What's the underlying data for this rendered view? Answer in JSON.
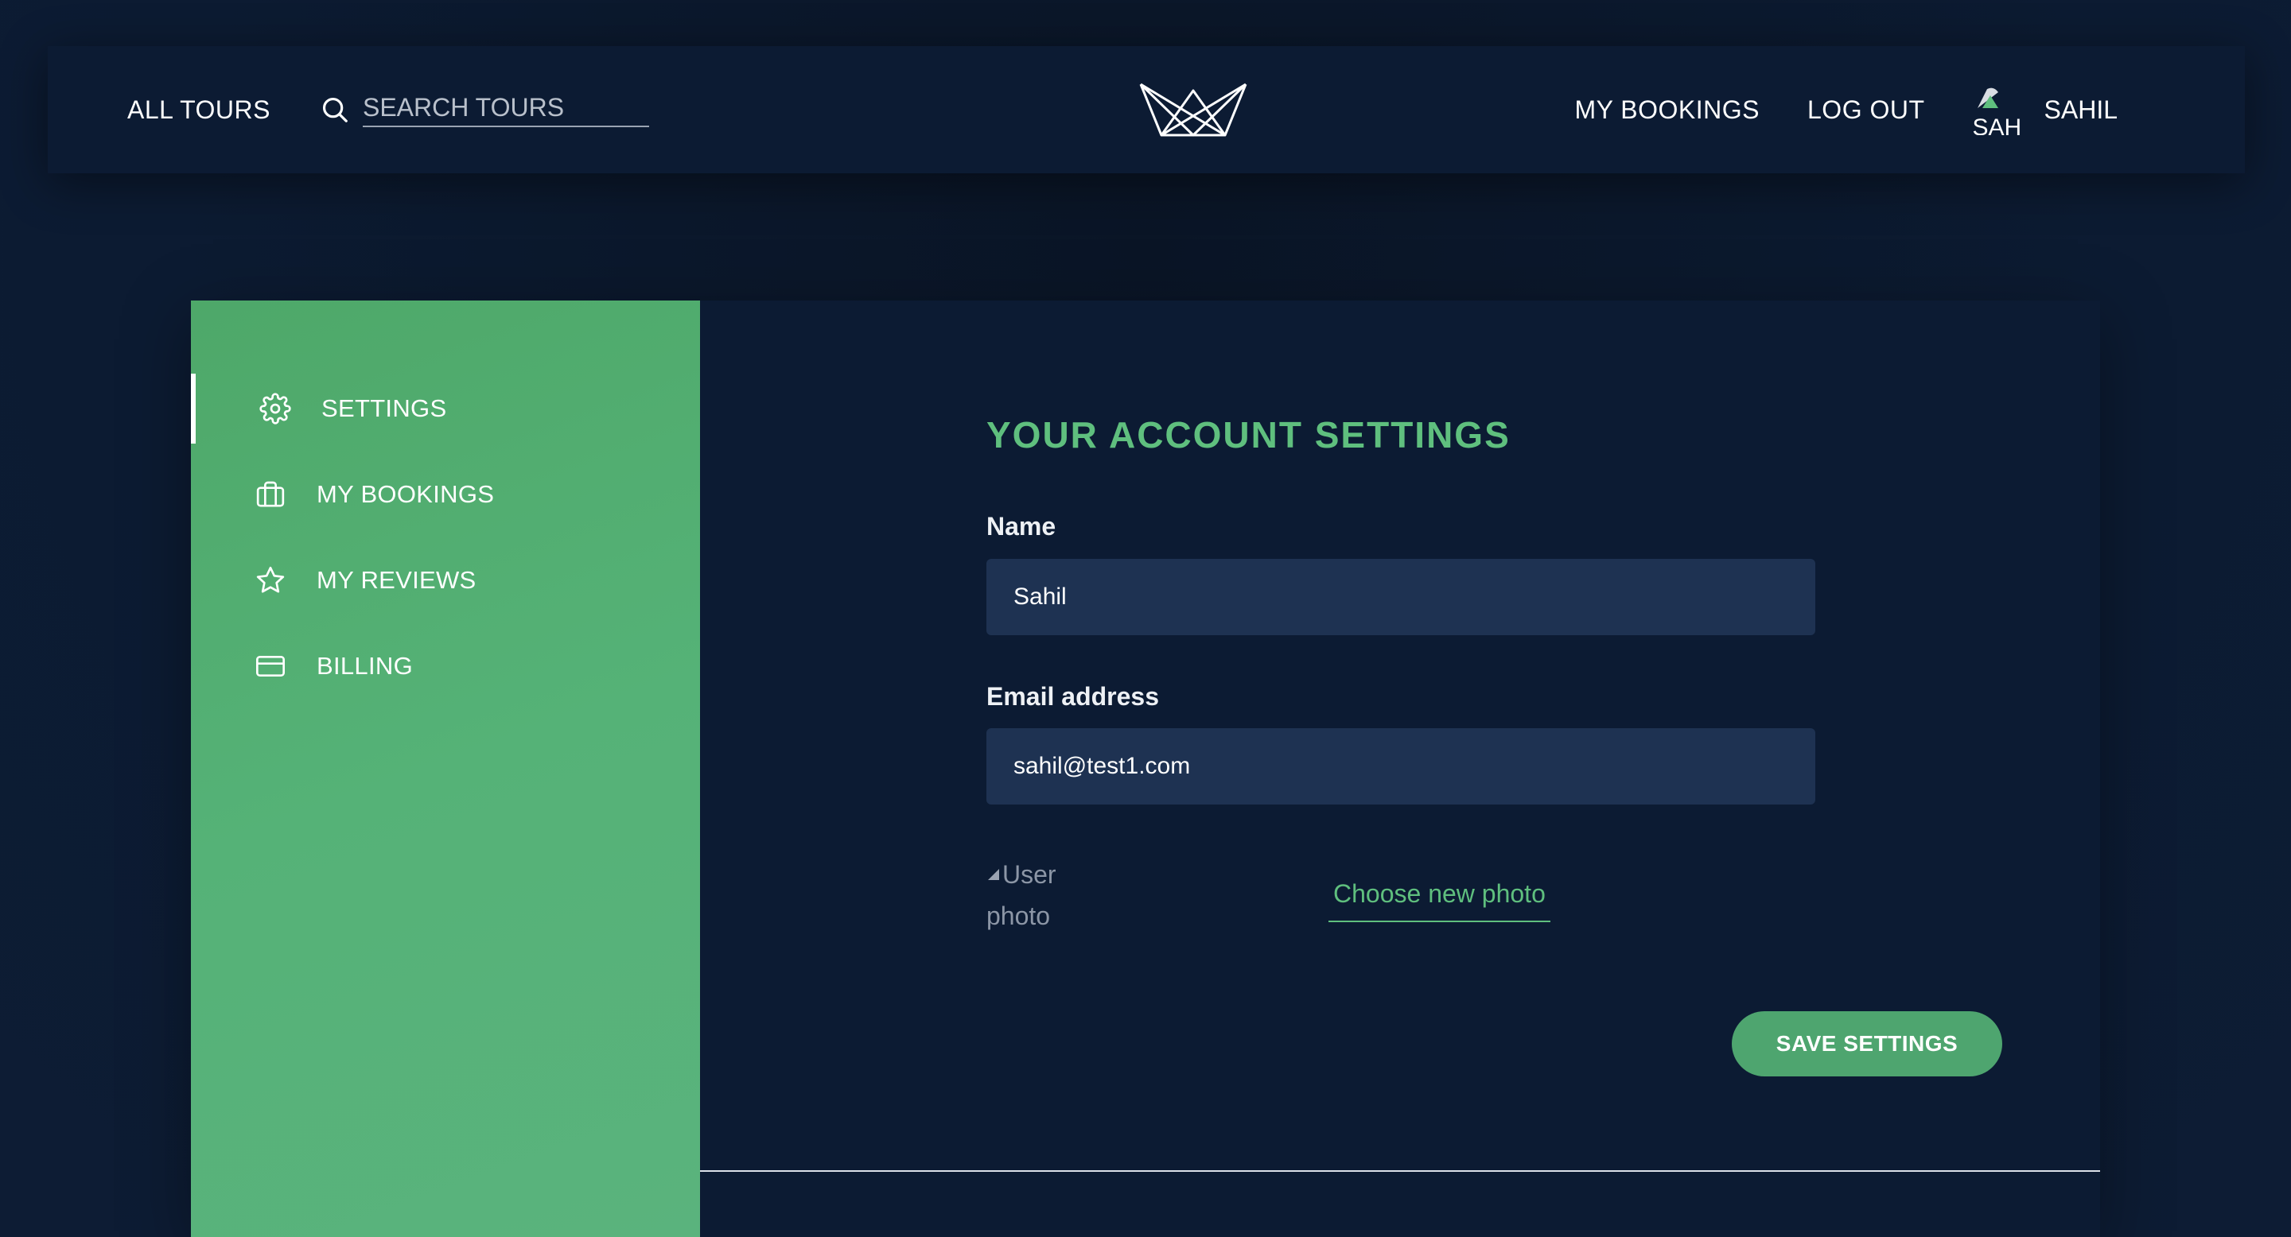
{
  "header": {
    "all_tours": "ALL TOURS",
    "search_placeholder": "SEARCH TOURS",
    "my_bookings": "MY BOOKINGS",
    "log_out": "LOG OUT",
    "avatar_alt": "SAH",
    "user_name": "SAHIL",
    "logo_icon": "crown-logo-icon",
    "search_icon": "search-icon"
  },
  "sidebar": {
    "items": [
      {
        "label": "SETTINGS",
        "icon": "gear-icon",
        "active": true
      },
      {
        "label": "MY BOOKINGS",
        "icon": "briefcase-icon",
        "active": false
      },
      {
        "label": "MY REVIEWS",
        "icon": "star-icon",
        "active": false
      },
      {
        "label": "BILLING",
        "icon": "credit-card-icon",
        "active": false
      }
    ]
  },
  "main": {
    "heading": "YOUR ACCOUNT SETTINGS",
    "name_label": "Name",
    "name_value": "Sahil",
    "email_label": "Email address",
    "email_value": "sahil@test1.com",
    "photo_alt": "User photo",
    "choose_photo": "Choose new photo",
    "save_button": "SAVE SETTINGS"
  },
  "colors": {
    "background": "#0c1b33",
    "sidebar_green": "#55b277",
    "accent_green": "#5fbf7e",
    "input_bg": "#1e3252",
    "button_green": "#4ea56f"
  }
}
